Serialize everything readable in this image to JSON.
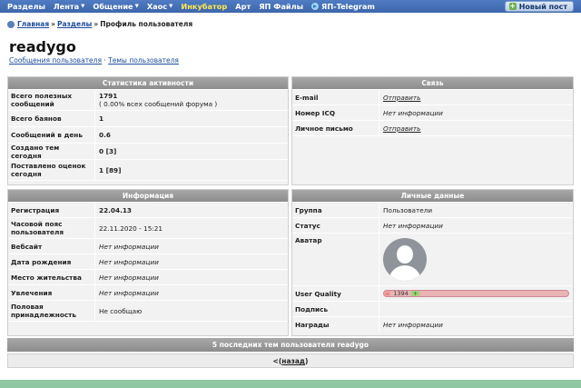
{
  "nav": {
    "items": [
      {
        "label": "Разделы",
        "dropdown": false,
        "highlight": false
      },
      {
        "label": "Лента",
        "dropdown": true,
        "highlight": false
      },
      {
        "label": "Общение",
        "dropdown": true,
        "highlight": false
      },
      {
        "label": "Хаос",
        "dropdown": true,
        "highlight": false
      },
      {
        "label": "Инкубатор",
        "dropdown": false,
        "highlight": true
      },
      {
        "label": "Арт",
        "dropdown": false,
        "highlight": false
      },
      {
        "label": "ЯП Файлы",
        "dropdown": false,
        "highlight": false
      },
      {
        "label": "ЯП-Telegram",
        "dropdown": false,
        "highlight": false,
        "icon": "telegram-icon"
      }
    ],
    "new_post_label": "Новый пост"
  },
  "breadcrumb": {
    "home": "Главная",
    "sections": "Разделы",
    "current": "Профиль пользователя",
    "sep": "»"
  },
  "profile": {
    "username": "readygo",
    "link_messages": "Сообщения пользователя",
    "link_sep": "·",
    "link_topics": "Темы пользователя"
  },
  "stats": {
    "header": "Статистика активности",
    "rows": [
      {
        "label": "Всего полезных сообщений",
        "value": "1791",
        "sub": "( 0.00% всех сообщений форума )"
      },
      {
        "label": "Всего баянов",
        "value": "1"
      },
      {
        "label": "Сообщений в день",
        "value": "0.6"
      },
      {
        "label": "Создано тем сегодня",
        "value": "0 [3]"
      },
      {
        "label": "Поставлено оценок сегодня",
        "value": "1 [89]"
      }
    ]
  },
  "contact": {
    "header": "Связь",
    "rows": [
      {
        "label": "E-mail",
        "value": "Отправить",
        "link": true
      },
      {
        "label": "Номер ICQ",
        "value": "Нет информации",
        "link": false
      },
      {
        "label": "Личное письмо",
        "value": "Отправить",
        "link": true
      }
    ]
  },
  "info": {
    "header": "Информация",
    "rows": [
      {
        "label": "Регистрация",
        "value": "22.04.13",
        "style": "bold"
      },
      {
        "label": "Часовой пояс пользователя",
        "value": "22.11.2020 - 15:21",
        "style": ""
      },
      {
        "label": "Вебсайт",
        "value": "Нет информации",
        "style": "italic"
      },
      {
        "label": "Дата рождения",
        "value": "Нет информации",
        "style": "italic"
      },
      {
        "label": "Место жительства",
        "value": "Нет информации",
        "style": "italic"
      },
      {
        "label": "Увлечения",
        "value": "Нет информации",
        "style": "italic"
      },
      {
        "label": "Половая принадлежность",
        "value": "Не сообщаю",
        "style": ""
      }
    ]
  },
  "personal": {
    "header": "Личные данные",
    "group_label": "Группа",
    "group_value": "Пользователи",
    "status_label": "Статус",
    "status_value": "Нет информации",
    "avatar_label": "Аватар",
    "quality_label": "User Quality",
    "quality_minus": "–",
    "quality_value": "1394",
    "quality_plus": "+",
    "signature_label": "Подпись",
    "awards_label": "Награды",
    "awards_value": "Нет информации"
  },
  "bottom": {
    "last_topics": "5 последних тем пользователя readygo",
    "pager_open": "<(",
    "pager_link": "назад",
    "pager_close": ")"
  }
}
